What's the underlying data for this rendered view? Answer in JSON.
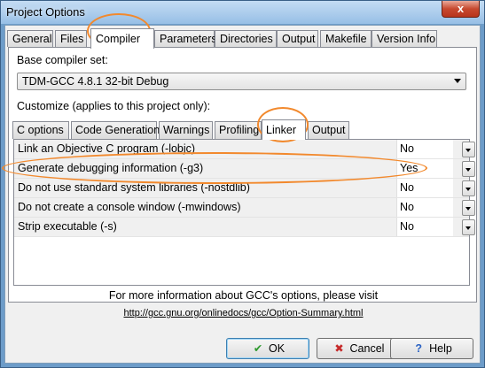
{
  "window": {
    "title": "Project Options",
    "close_label": "x"
  },
  "top_tabs": [
    {
      "label": "General"
    },
    {
      "label": "Files"
    },
    {
      "label": "Compiler"
    },
    {
      "label": "Parameters"
    },
    {
      "label": "Directories"
    },
    {
      "label": "Output"
    },
    {
      "label": "Makefile"
    },
    {
      "label": "Version Info"
    }
  ],
  "compiler": {
    "base_set_label": "Base compiler set:",
    "base_set_value": "TDM-GCC 4.8.1 32-bit Debug",
    "customize_label": "Customize (applies to this project only):"
  },
  "inner_tabs": [
    {
      "label": "C options"
    },
    {
      "label": "Code Generation"
    },
    {
      "label": "Warnings"
    },
    {
      "label": "Profiling"
    },
    {
      "label": "Linker"
    },
    {
      "label": "Output"
    }
  ],
  "linker_options": [
    {
      "label": "Link an Objective C program (-lobjc)",
      "value": "No"
    },
    {
      "label": "Generate debugging information (-g3)",
      "value": "Yes"
    },
    {
      "label": "Do not use standard system libraries (-nostdlib)",
      "value": "No"
    },
    {
      "label": "Do not create a console window (-mwindows)",
      "value": "No"
    },
    {
      "label": "Strip executable (-s)",
      "value": "No"
    }
  ],
  "info": {
    "text": "For more information about GCC's options, please visit",
    "link": "http://gcc.gnu.org/onlinedocs/gcc/Option-Summary.html"
  },
  "buttons": {
    "ok": "OK",
    "cancel": "Cancel",
    "help": "Help"
  },
  "colors": {
    "annotation": "#f2892d",
    "ok_check": "#2f9a2f",
    "cancel_x": "#c62a2a",
    "help_q": "#2b63c4"
  }
}
